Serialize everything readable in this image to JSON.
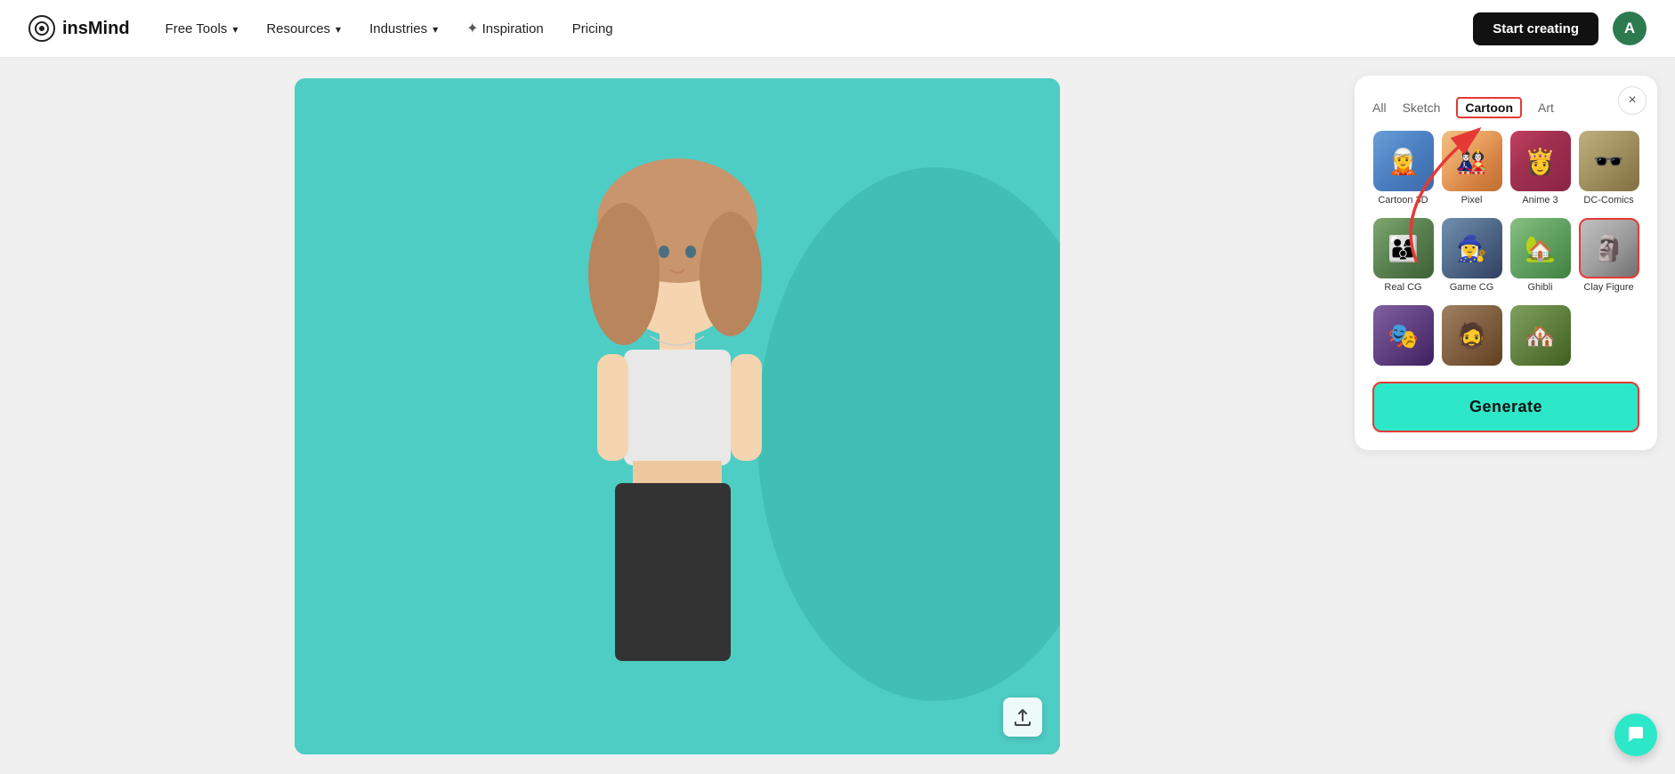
{
  "navbar": {
    "logo_text": "insMind",
    "nav_items": [
      {
        "label": "Free Tools",
        "has_dropdown": true
      },
      {
        "label": "Resources",
        "has_dropdown": true
      },
      {
        "label": "Industries",
        "has_dropdown": true
      },
      {
        "label": "Inspiration",
        "has_spark": true
      },
      {
        "label": "Pricing",
        "has_dropdown": false
      }
    ],
    "start_button": "Start creating",
    "avatar_letter": "A"
  },
  "filter_tabs": [
    {
      "id": "all",
      "label": "All",
      "active": false
    },
    {
      "id": "sketch",
      "label": "Sketch",
      "active": false
    },
    {
      "id": "cartoon",
      "label": "Cartoon",
      "active": true
    },
    {
      "id": "art",
      "label": "Art",
      "active": false
    }
  ],
  "style_items_row1": [
    {
      "id": "cartoon3d",
      "label": "Cartoon 3D",
      "thumb_class": "thumb-cartoon3d"
    },
    {
      "id": "pixel",
      "label": "Pixel",
      "thumb_class": "thumb-pixel"
    },
    {
      "id": "anime3",
      "label": "Anime 3",
      "thumb_class": "thumb-anime3"
    },
    {
      "id": "dccomics",
      "label": "DC-Comics",
      "thumb_class": "thumb-dccomics"
    }
  ],
  "style_items_row2": [
    {
      "id": "realcg",
      "label": "Real CG",
      "thumb_class": "thumb-realcg"
    },
    {
      "id": "gamecg",
      "label": "Game CG",
      "thumb_class": "thumb-gamecg"
    },
    {
      "id": "ghibli",
      "label": "Ghibli",
      "thumb_class": "thumb-ghibli"
    },
    {
      "id": "clayfigure",
      "label": "Clay Figure",
      "thumb_class": "thumb-clayfigure",
      "highlighted": true
    }
  ],
  "style_items_row3": [
    {
      "id": "row3a",
      "label": "",
      "thumb_class": "thumb-row3a"
    },
    {
      "id": "row3b",
      "label": "",
      "thumb_class": "thumb-row3b"
    },
    {
      "id": "row3c",
      "label": "",
      "thumb_class": "thumb-row3c"
    }
  ],
  "generate_button": "Generate",
  "close_button": "×",
  "upload_icon": "↑"
}
